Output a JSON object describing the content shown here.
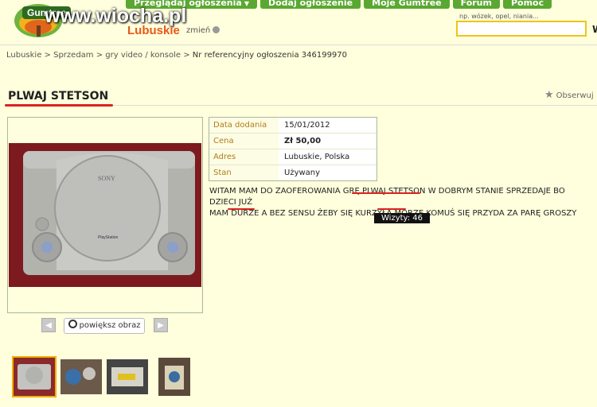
{
  "brand": {
    "badge": "Gumtree",
    "watermark": "www.wiocha.pl"
  },
  "topnav": [
    {
      "label": "Przeglądaj ogłoszenia",
      "dropdown": true
    },
    {
      "label": "Dodaj ogłoszenie"
    },
    {
      "label": "Moje Gumtree"
    },
    {
      "label": "Forum"
    },
    {
      "label": "Pomoc"
    }
  ],
  "location": {
    "region": "Lubuskie",
    "change_label": "zmień"
  },
  "search": {
    "hint": "np. wózek, opel, niania...",
    "value": "",
    "button_label": "W"
  },
  "breadcrumb": [
    "Lubuskie",
    "Sprzedam",
    "gry video / konsole",
    "Nr referencyjny ogłoszenia 346199970"
  ],
  "listing": {
    "title": "PLWAJ STETSON",
    "watch_label": "Obserwuj",
    "details": [
      {
        "label": "Data dodania",
        "value": "15/01/2012"
      },
      {
        "label": "Cena",
        "value": "Zł  50,00"
      },
      {
        "label": "Adres",
        "value": "Lubuskie, Polska"
      },
      {
        "label": "Stan",
        "value": "Używany"
      }
    ],
    "description_line1": "WITAM MAM DO ZAOFEROWANIA GRĘ PLWAJ STETSON W DOBRYM STANIE SPRZEDAJE BO DZIECI JUŻ",
    "description_line2": "MAM DURZE A BEZ SENSU ŻEBY SIĘ KURZYŁA MORZE KOMUŚ SIĘ PRZYDA ZA PARĘ GROSZY",
    "visits_label": "Wizyty: 46"
  },
  "photo": {
    "brand_text": "SONY",
    "logo_text": "PlayStation"
  },
  "gallery": {
    "zoom_label": "powiększ obraz",
    "prev_icon": "chevron-left-icon",
    "next_icon": "chevron-right-icon",
    "thumbnails": 4
  },
  "colors": {
    "nav_green": "#5aa832",
    "region_orange": "#e8581a",
    "highlight": "#d22",
    "page_bg": "#ffffdd"
  }
}
